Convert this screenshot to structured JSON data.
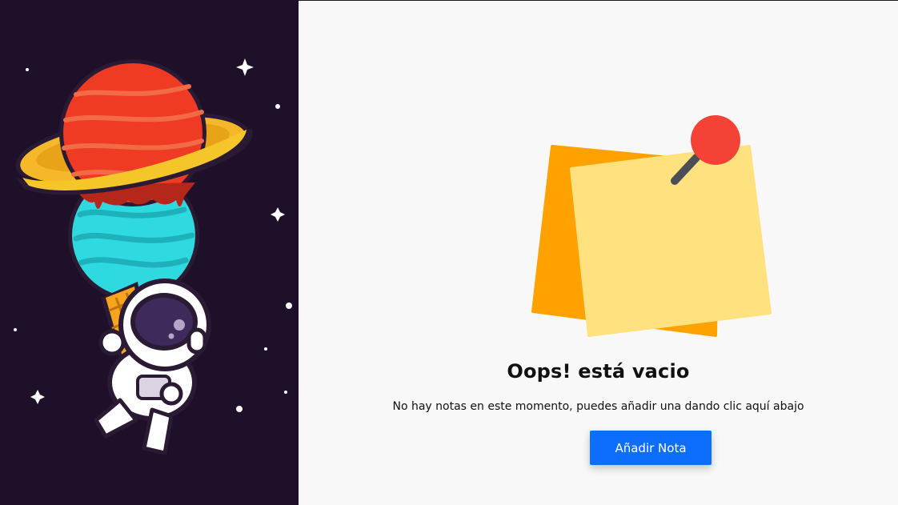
{
  "illustration": {
    "left_icon": "astronaut-planet-icecream-icon",
    "right_icon": "sticky-notes-pin-icon"
  },
  "empty_state": {
    "title": "Oops! está vacio",
    "message": "No hay notas en este momento, puedes añadir una dando clic aquí abajo",
    "button_label": "Añadir Nota"
  },
  "colors": {
    "left_bg": "#1f1029",
    "right_bg": "#f8f8f8",
    "button_bg": "#0d6efd",
    "note_back": "#ffa200",
    "note_front": "#ffe17f",
    "pin": "#f44336"
  }
}
